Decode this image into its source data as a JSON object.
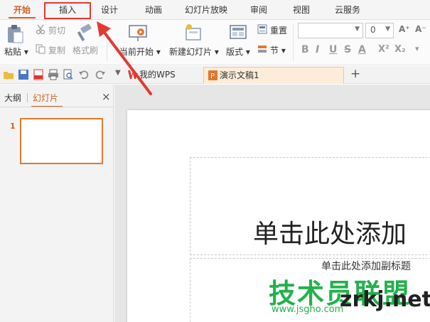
{
  "menu": {
    "tabs": [
      "开始",
      "插入",
      "设计",
      "动画",
      "幻灯片放映",
      "审阅",
      "视图",
      "云服务"
    ],
    "active": "开始"
  },
  "ribbon": {
    "paste_label": "粘贴",
    "cut_label": "剪切",
    "copy_label": "复制",
    "format_painter_label": "格式刷",
    "from_current_label": "当前开始",
    "new_slide_label": "新建幻灯片",
    "layout_label": "版式",
    "reset_label": "重置",
    "section_label": "节",
    "font_name_value": "",
    "font_size_value": "0",
    "format_buttons": [
      "B",
      "I",
      "U",
      "S",
      "A",
      "X²",
      "X₂"
    ],
    "grow_font": "A⁺",
    "shrink_font": "A⁻"
  },
  "tabs": {
    "home_tab": "我的WPS",
    "doc_tab": "演示文稿1",
    "add": "+"
  },
  "panel": {
    "outline_tab": "大纲",
    "slides_tab": "幻灯片",
    "close": "×",
    "slide_number": "1"
  },
  "slide": {
    "title_placeholder": "单击此处添加",
    "subtitle_placeholder": "单击此处添加副标题"
  },
  "watermark": {
    "brand": "技术员联盟",
    "site": "zrkj.net",
    "url": "www.jsgho.com"
  },
  "colors": {
    "accent": "#d4601f",
    "annotation": "#e33a2f",
    "watermark_green": "#22b14c"
  }
}
